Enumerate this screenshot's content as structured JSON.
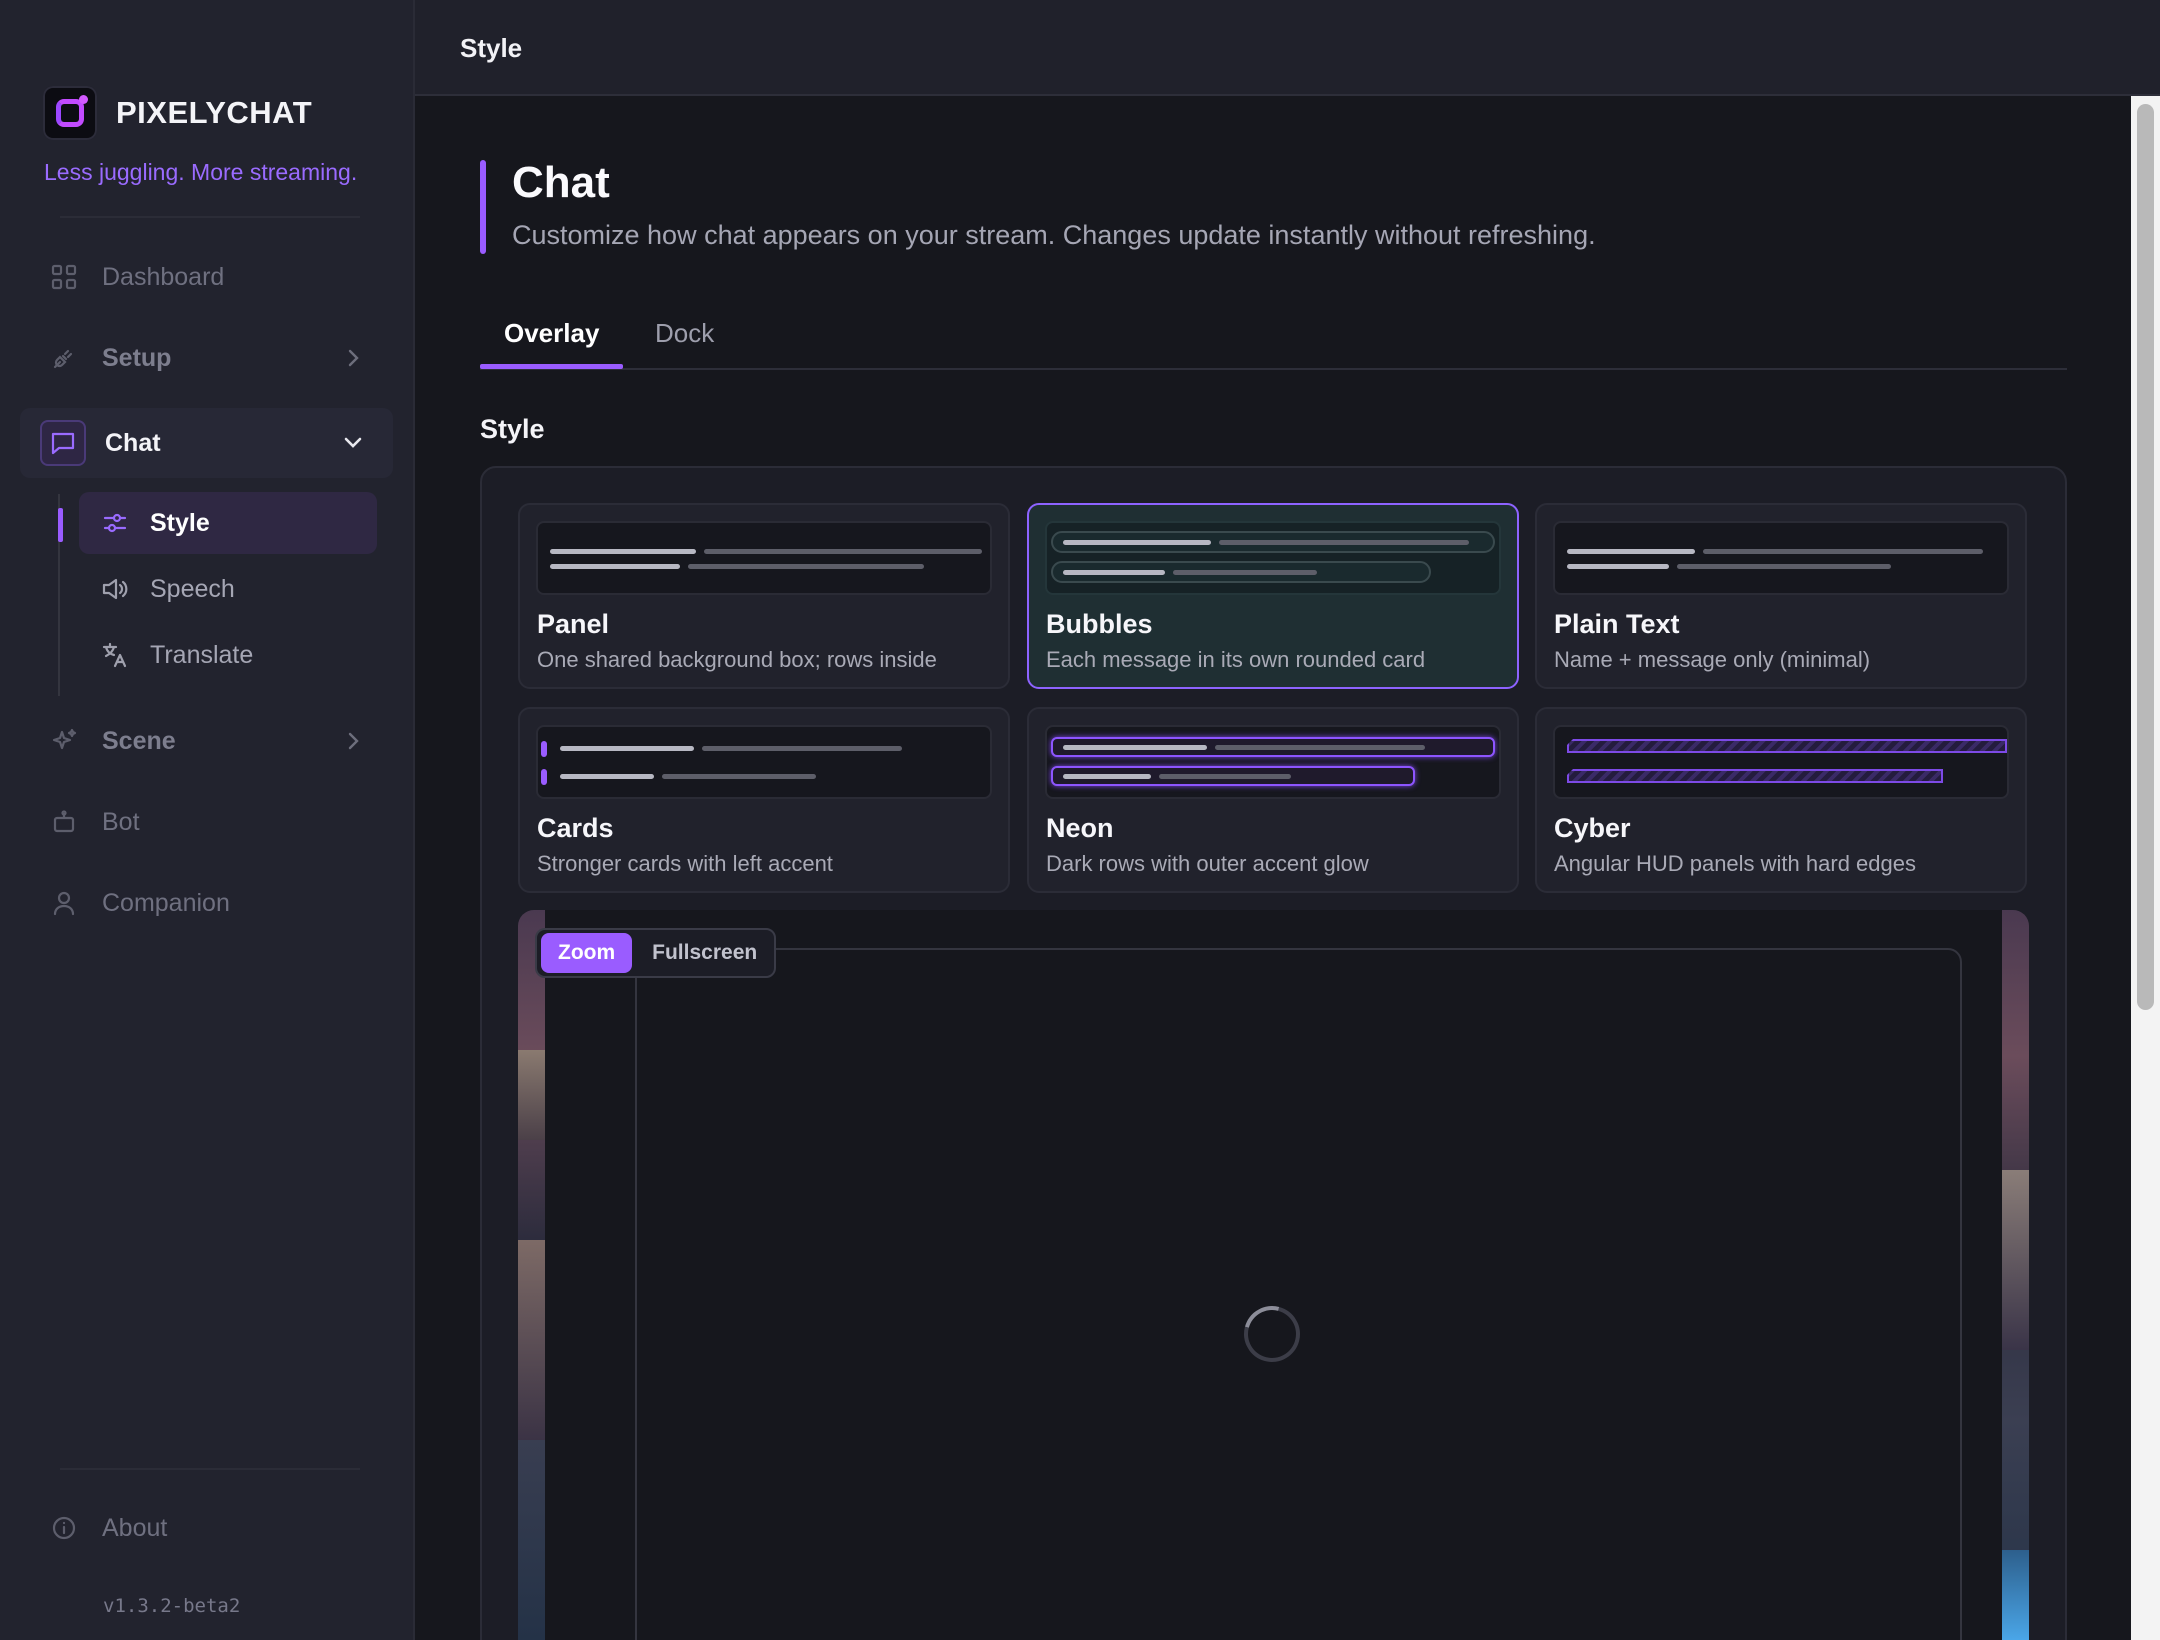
{
  "app": {
    "name": "PIXELYCHAT",
    "tagline": "Less juggling. More streaming.",
    "version": "v1.3.2-beta2",
    "accent": "#9a5cff"
  },
  "topbar": {
    "title": "Style"
  },
  "sidebar": {
    "items": [
      {
        "label": "Dashboard",
        "icon": "grid-icon"
      },
      {
        "label": "Setup",
        "icon": "plug-icon"
      },
      {
        "label": "Chat",
        "icon": "chat-bubble-icon",
        "expanded": true
      },
      {
        "label": "Scene",
        "icon": "sparkle-icon"
      },
      {
        "label": "Bot",
        "icon": "robot-icon"
      },
      {
        "label": "Companion",
        "icon": "person-icon"
      }
    ],
    "chat_sub": [
      {
        "label": "Style",
        "icon": "sliders-icon",
        "active": true
      },
      {
        "label": "Speech",
        "icon": "speaker-icon"
      },
      {
        "label": "Translate",
        "icon": "translate-icon"
      }
    ],
    "about": {
      "label": "About",
      "icon": "info-icon"
    }
  },
  "page": {
    "title": "Chat",
    "subtitle": "Customize how chat appears on your stream. Changes update instantly without refreshing.",
    "tabs": [
      {
        "label": "Overlay",
        "active": true
      },
      {
        "label": "Dock"
      }
    ],
    "section_title": "Style"
  },
  "styles": [
    {
      "title": "Panel",
      "desc": "One shared background box; rows inside"
    },
    {
      "title": "Bubbles",
      "desc": "Each message in its own rounded card",
      "selected": true
    },
    {
      "title": "Plain Text",
      "desc": "Name + message only (minimal)"
    },
    {
      "title": "Cards",
      "desc": "Stronger cards with left accent"
    },
    {
      "title": "Neon",
      "desc": "Dark rows with outer accent glow"
    },
    {
      "title": "Cyber",
      "desc": "Angular HUD panels with hard edges"
    }
  ],
  "preview": {
    "zoom_label": "Zoom",
    "fullscreen_label": "Fullscreen"
  }
}
